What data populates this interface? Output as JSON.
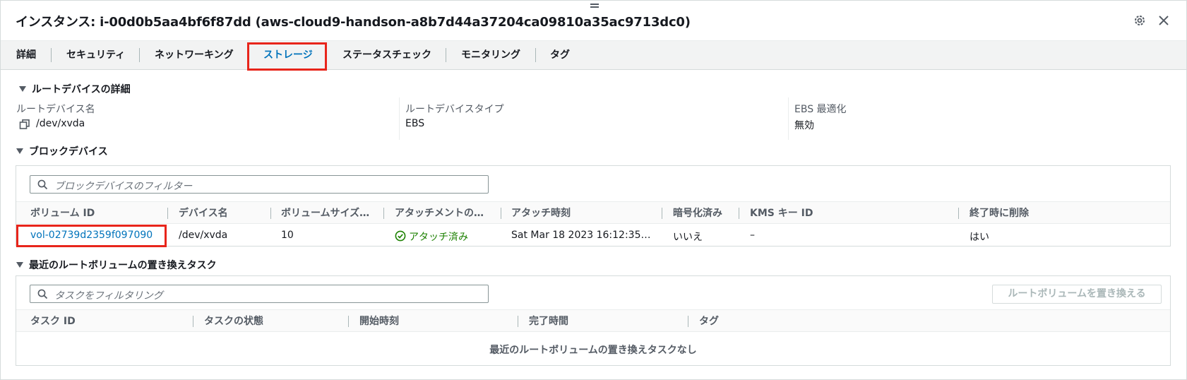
{
  "header": {
    "title": "インスタンス: i-00d0b5aa4bf6f87dd (aws-cloud9-handson-a8b7d44a37204ca09810a35ac9713dc0)",
    "settings_icon": "gear-icon",
    "close_icon": "close-icon"
  },
  "tabs": [
    {
      "label": "詳細"
    },
    {
      "label": "セキュリティ"
    },
    {
      "label": "ネットワーキング"
    },
    {
      "label": "ストレージ",
      "active": true
    },
    {
      "label": "ステータスチェック"
    },
    {
      "label": "モニタリング"
    },
    {
      "label": "タグ"
    }
  ],
  "root_device": {
    "heading": "ルートデバイスの詳細",
    "name_label": "ルートデバイス名",
    "name_value": "/dev/xvda",
    "type_label": "ルートデバイスタイプ",
    "type_value": "EBS",
    "ebs_label": "EBS 最適化",
    "ebs_value": "無効"
  },
  "block_devices": {
    "heading": "ブロックデバイス",
    "filter_placeholder": "ブロックデバイスのフィルター",
    "columns": [
      "ボリューム ID",
      "デバイス名",
      "ボリュームサイズ…",
      "アタッチメントの…",
      "アタッチ時刻",
      "暗号化済み",
      "KMS キー ID",
      "終了時に削除"
    ],
    "rows": [
      {
        "volume_id": "vol-02739d2359f097090",
        "device": "/dev/xvda",
        "size": "10",
        "attachment": "アタッチ済み",
        "attach_time": "Sat Mar 18 2023 16:12:35 G…",
        "encrypted": "いいえ",
        "kms": "–",
        "delete_on_term": "はい"
      }
    ]
  },
  "replace_tasks": {
    "heading": "最近のルートボリュームの置き換えタスク",
    "filter_placeholder": "タスクをフィルタリング",
    "replace_button": "ルートボリュームを置き換える",
    "columns": [
      "タスク ID",
      "タスクの状態",
      "開始時刻",
      "完了時間",
      "タグ"
    ],
    "empty_message": "最近のルートボリュームの置き換えタスクなし"
  },
  "colors": {
    "accent": "#0073bb",
    "highlight": "#e8251b",
    "success": "#1d8102"
  }
}
